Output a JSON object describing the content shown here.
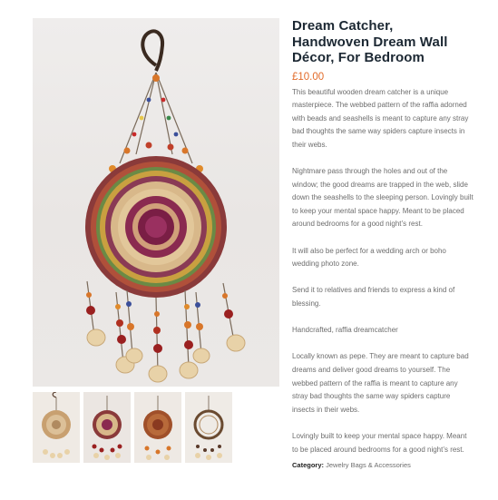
{
  "product": {
    "title": "Dream Catcher, Handwoven Dream Wall Décor, For Bedroom",
    "price": "£10.00",
    "description": [
      "This beautiful wooden dream catcher is a unique masterpiece. The webbed pattern of the raffia adorned with beads and seashells is meant to capture any stray bad thoughts the same way spiders capture insects in their webs.",
      "Nightmare pass through the holes and out of the window; the good dreams are trapped in the web, slide down the seashells to the sleeping person. Lovingly built to keep your mental space happy.  Meant to be placed around bedrooms for a good night’s rest.",
      "It will also be perfect for a wedding arch or boho wedding photo zone.",
      "Send it to relatives and friends to express a kind of blessing.",
      "Handcrafted, raffia dreamcatcher",
      "Locally known as pepe. They are meant to capture bad dreams and deliver good dreams to yourself. The webbed pattern of the raffia is meant to capture any stray bad thoughts the same way spiders capture insects in their webs.",
      "Lovingly built to keep your mental space happy. Meant to be placed around bedrooms for a good night’s rest."
    ],
    "category_label": "Category:",
    "category_value": "Jewelry Bags & Accessories"
  },
  "colors": {
    "title": "#1c2833",
    "price": "#e26b2a",
    "body_text": "#6d6d6d"
  }
}
